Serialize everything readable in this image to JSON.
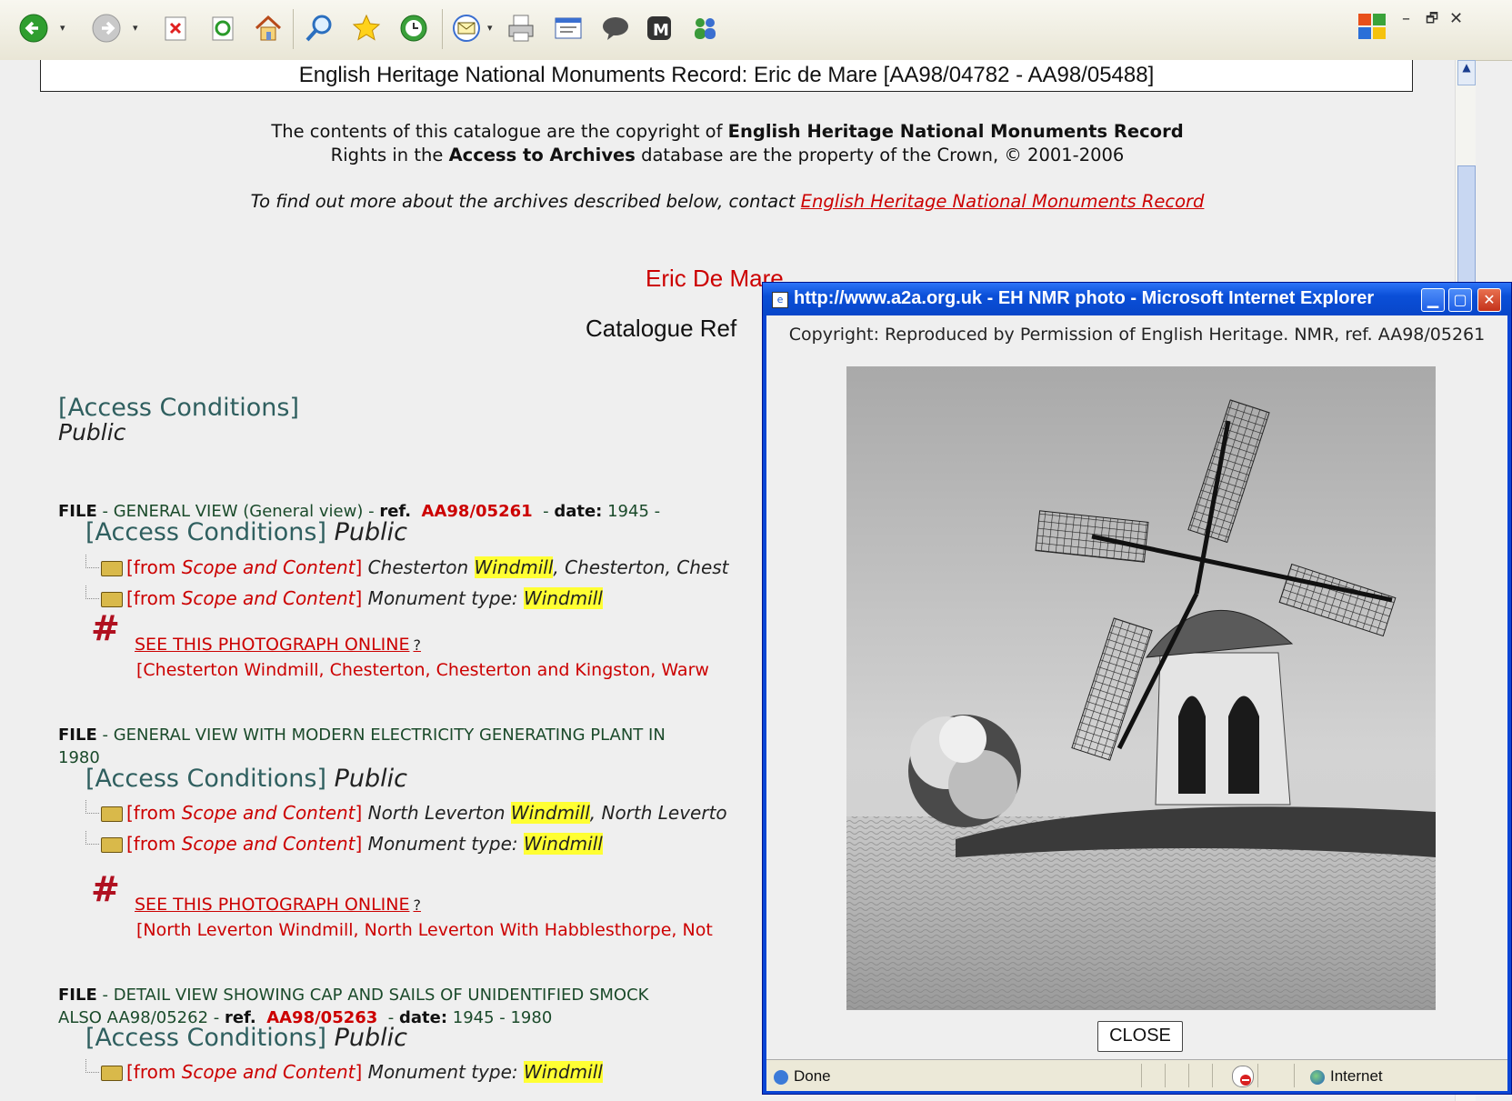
{
  "browser": {
    "toolbar_icons": [
      "back-icon",
      "forward-icon",
      "stop-icon",
      "refresh-icon",
      "home-icon",
      "search-icon",
      "favorites-icon",
      "history-icon",
      "mail-icon",
      "print-icon",
      "edit-icon",
      "discuss-icon",
      "messenger-icon",
      "contacts-icon"
    ],
    "window_controls": {
      "minimize": "–",
      "restore": "🗗",
      "close": "✕"
    }
  },
  "page": {
    "banner": "English Heritage National Monuments Record: Eric de Mare [AA98/04782 - AA98/05488]",
    "copyright_line1_pre": "The contents of this catalogue are the copyright of ",
    "copyright_line1_bold": "English Heritage National Monuments Record",
    "copyright_line2_pre": "Rights in the ",
    "copyright_line2_bold": "Access to Archives",
    "copyright_line2_post": " database are the property of the Crown, © 2001-2006",
    "findout_text": "To find out more about the archives described below, contact ",
    "findout_link": "English Heritage National Monuments Record",
    "creator": "Eric De Mare",
    "catalogue_ref": "Catalogue Ref",
    "access_heading": "[Access Conditions]",
    "access_value": "Public",
    "entries": [
      {
        "file_label": "FILE",
        "file_desc": " - GENERAL VIEW (General view) - ",
        "ref_label": "ref.",
        "ref_value": "AA98/05261",
        "date_label": "date:",
        "date_value": " 1945 -",
        "access_heading": "[Access Conditions]",
        "access_value": "Public",
        "scope1_from": "[from ",
        "scope1_sc": "Scope and Content",
        "scope1_close": "]",
        "scope1_pre": " Chesterton ",
        "scope1_hl": "Windmill",
        "scope1_post": ", Chesterton, Chest",
        "scope2_from": "[from ",
        "scope2_sc": "Scope and Content",
        "scope2_close": "]",
        "scope2_pre": " Monument type: ",
        "scope2_hl": "Windmill",
        "see_online": "SEE THIS PHOTOGRAPH ONLINE",
        "caption": "[Chesterton Windmill, Chesterton, Chesterton and Kingston, Warw"
      },
      {
        "file_label": "FILE",
        "file_desc": " - GENERAL VIEW WITH MODERN ELECTRICITY GENERATING PLANT IN",
        "file_cont": "1980",
        "access_heading": "[Access Conditions]",
        "access_value": "Public",
        "scope1_from": "[from ",
        "scope1_sc": "Scope and Content",
        "scope1_close": "]",
        "scope1_pre": " North Leverton ",
        "scope1_hl": "Windmill",
        "scope1_post": ", North Leverto",
        "scope2_from": "[from ",
        "scope2_sc": "Scope and Content",
        "scope2_close": "]",
        "scope2_pre": " Monument type: ",
        "scope2_hl": "Windmill",
        "see_online": "SEE THIS PHOTOGRAPH ONLINE",
        "caption": "[North Leverton Windmill, North Leverton With Habblesthorpe, Not"
      },
      {
        "file_label": "FILE",
        "file_desc": " - DETAIL VIEW SHOWING CAP AND SAILS OF UNIDENTIFIED SMOCK",
        "cont_pre": "ALSO AA98/05262 - ",
        "ref_label": "ref.",
        "ref_value": "AA98/05263",
        "date_label": "date:",
        "date_value": " 1945 - 1980",
        "access_heading": "[Access Conditions]",
        "access_value": "Public",
        "scope2_from": "[from ",
        "scope2_sc": "Scope and Content",
        "scope2_close": "]",
        "scope2_pre": " Monument type: ",
        "scope2_hl": "Windmill"
      }
    ]
  },
  "popup": {
    "title": "http://www.a2a.org.uk - EH NMR photo - Microsoft Internet Explorer",
    "copyright": "Copyright: Reproduced by Permission of English Heritage. NMR, ref. AA98/05261",
    "close_label": "CLOSE",
    "status_text": "Done",
    "zone_text": "Internet"
  }
}
